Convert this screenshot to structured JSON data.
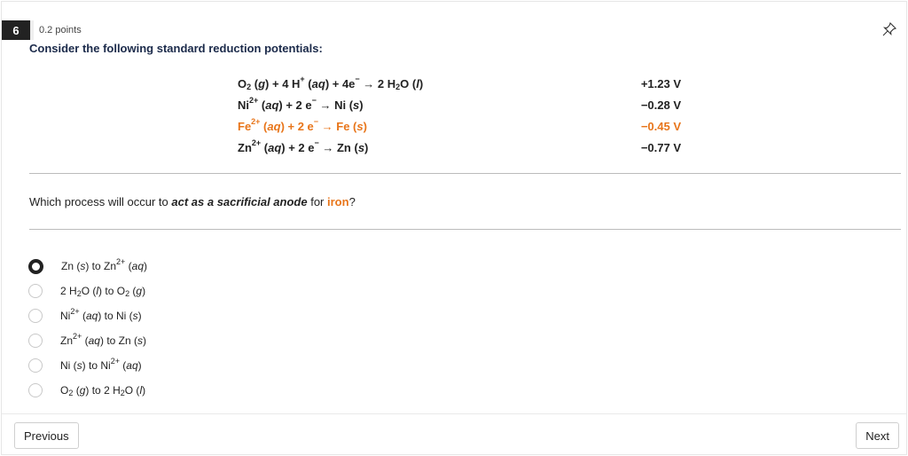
{
  "question": {
    "number": "6",
    "points": "0.2 points",
    "heading": "Consider the following standard reduction potentials:"
  },
  "reactions": [
    {
      "html": "O<sub>2</sub> (<i>g</i>) + 4 H<sup>+</sup> (<i>aq</i>) + 4e<sup>−</sup> → 2 H<sub>2</sub>O (<i>l</i>)",
      "potential": "+1.23 V",
      "highlight": false
    },
    {
      "html": "Ni<sup>2+</sup> (<i>aq</i>) + 2 e<sup>−</sup> → Ni (<i>s</i>)",
      "potential": "−0.28 V",
      "highlight": false
    },
    {
      "html": "Fe<sup>2+</sup> (<i>aq</i>) + 2 e<sup>−</sup> → Fe (<i>s</i>)",
      "potential": "−0.45 V",
      "highlight": true
    },
    {
      "html": "Zn<sup>2+</sup> (<i>aq</i>) + 2 e<sup>−</sup> → Zn (<i>s</i>)",
      "potential": "−0.77 V",
      "highlight": false
    }
  ],
  "prompt": {
    "before": "Which process will occur to ",
    "emphasis": "act as a sacrificial anode",
    "middle": " for ",
    "highlight": "iron",
    "after": "?"
  },
  "options": [
    {
      "html": "Zn (<i>s</i>) to Zn<sup>2+</sup> (<i>aq</i>)",
      "selected": true
    },
    {
      "html": "2 H<sub>2</sub>O (<i>l</i>) to O<sub>2</sub> (<i>g</i>)",
      "selected": false
    },
    {
      "html": "Ni<sup>2+</sup> (<i>aq</i>) to Ni (<i>s</i>)",
      "selected": false
    },
    {
      "html": "Zn<sup>2+</sup> (<i>aq</i>) to Zn (<i>s</i>)",
      "selected": false
    },
    {
      "html": "Ni (<i>s</i>) to Ni<sup>2+</sup> (<i>aq</i>)",
      "selected": false
    },
    {
      "html": "O<sub>2</sub> (<i>g</i>) to 2 H<sub>2</sub>O (<i>l</i>)",
      "selected": false
    }
  ],
  "nav": {
    "previous_label": "Previous",
    "next_label": "Next"
  },
  "icons": {
    "pin": "pin-icon"
  },
  "colors": {
    "highlight": "#e8751a",
    "question_badge": "#222222",
    "heading": "#1b2a4a"
  }
}
